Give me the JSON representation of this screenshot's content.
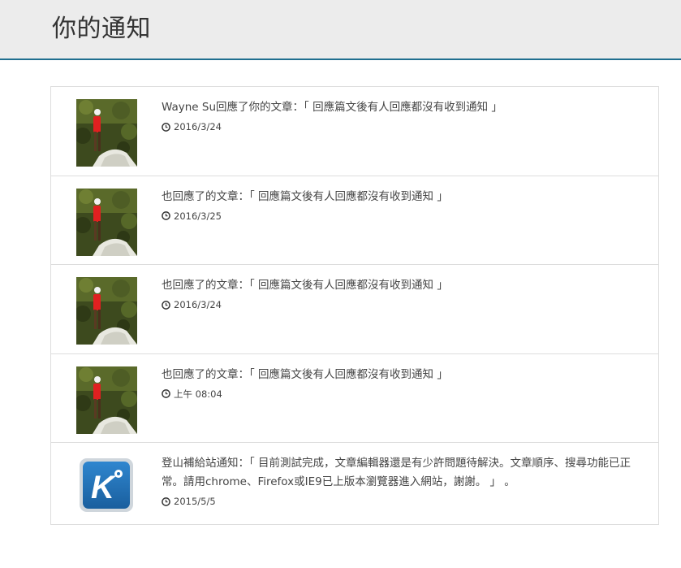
{
  "header": {
    "title": "你的通知"
  },
  "notifications": [
    {
      "avatar": "hiker-photo",
      "message": "Wayne Su回應了你的文章：「 回應篇文後有人回應都沒有收到通知 」",
      "time": "2016/3/24"
    },
    {
      "avatar": "hiker-photo",
      "message": "也回應了的文章：「 回應篇文後有人回應都沒有收到通知 」",
      "time": "2016/3/25"
    },
    {
      "avatar": "hiker-photo",
      "message": "也回應了的文章：「 回應篇文後有人回應都沒有收到通知 」",
      "time": "2016/3/24"
    },
    {
      "avatar": "hiker-photo",
      "message": "也回應了的文章：「 回應篇文後有人回應都沒有收到通知 」",
      "time": "上午 08:04"
    },
    {
      "avatar": "site-logo-k",
      "message": "登山補給站通知：「 目前測試完成，文章編輯器還是有少許問題待解決。文章順序、搜尋功能已正常。請用chrome、Firefox或IE9已上版本瀏覽器進入網站，謝謝。 」 。",
      "time": "2015/5/5"
    }
  ],
  "colors": {
    "header_bg": "#ececec",
    "header_border": "#1f6f8f",
    "logo_blue": "#1f6fb5"
  }
}
